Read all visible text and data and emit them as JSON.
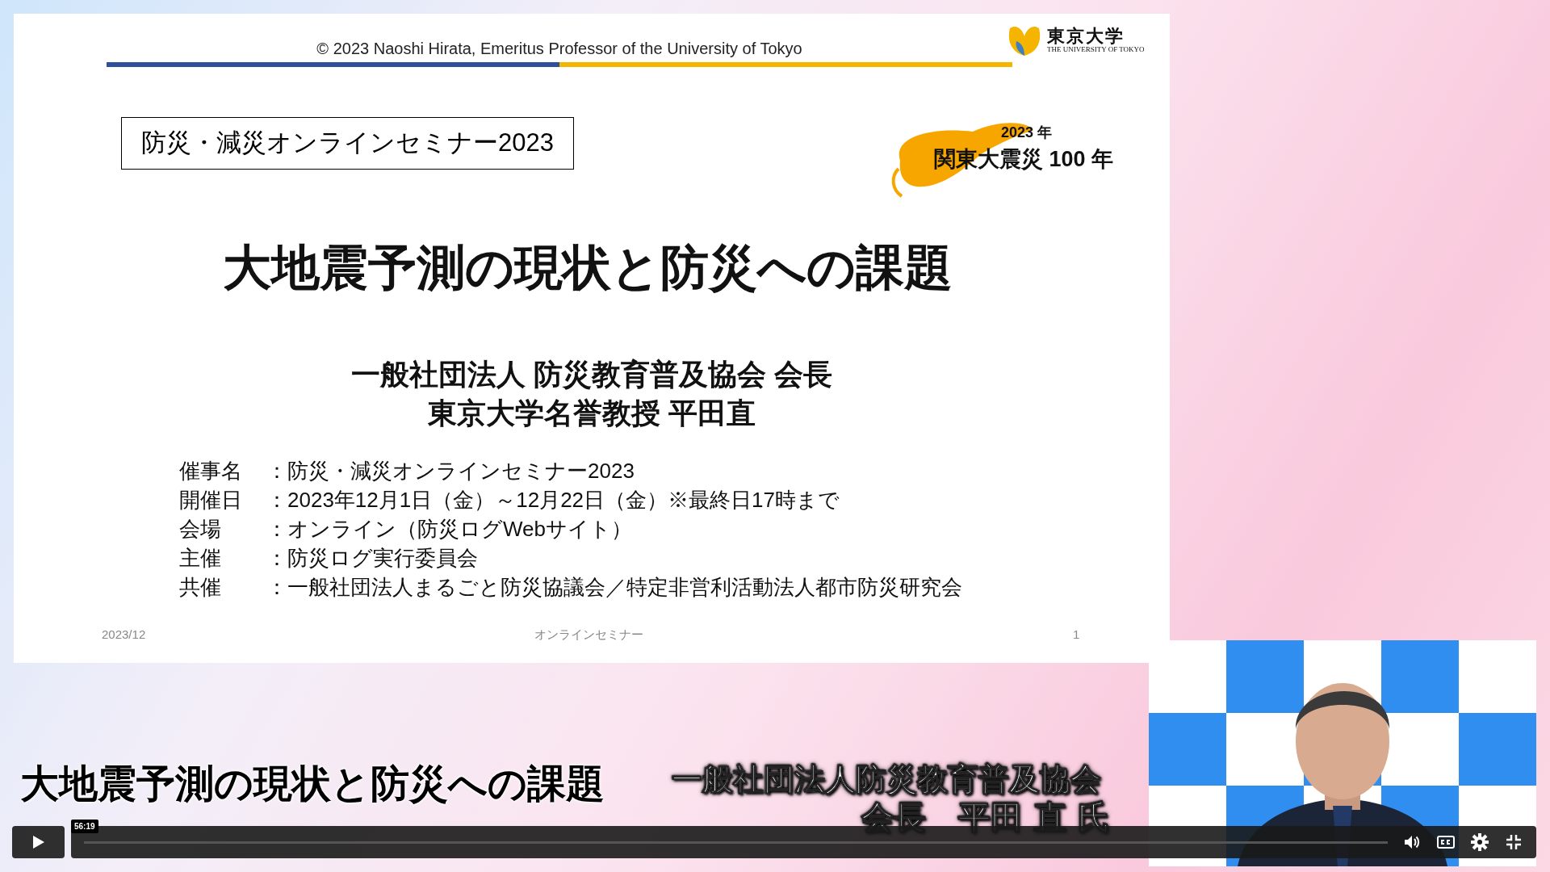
{
  "slide": {
    "header": "© 2023  Naoshi Hirata, Emeritus Professor of the University of Tokyo",
    "logo": {
      "name": "東京大学",
      "subtitle": "THE UNIVERSITY OF TOKYO"
    },
    "event_box": "防災・減災オンラインセミナー2023",
    "badge": {
      "year": "2023 年",
      "title": "関東大震災 100 年"
    },
    "title": "大地震予測の現状と防災への課題",
    "presenter": [
      "一般社団法人 防災教育普及協会 会長",
      "東京大学名誉教授 平田直"
    ],
    "details": [
      {
        "label": "催事名",
        "value": "：防災・減災オンラインセミナー2023"
      },
      {
        "label": "開催日",
        "value": "：2023年12月1日（金）～12月22日（金）※最終日17時まで"
      },
      {
        "label": "会場",
        "value": "：オンライン（防災ログWebサイト）"
      },
      {
        "label": "主催",
        "value": "：防災ログ実行委員会"
      },
      {
        "label": "共催",
        "value": "：一般社団法人まるごと防災協議会／特定非営利活動法人都市防災研究会"
      }
    ],
    "footer": {
      "date": "2023/12",
      "center": "オンラインセミナー",
      "page": "1"
    }
  },
  "captions": {
    "title": "大地震予測の現状と防災への課題",
    "organization": "一般社団法人防災教育普及協会",
    "name": "会長　平田 直 氏"
  },
  "player": {
    "time": "56:19"
  }
}
